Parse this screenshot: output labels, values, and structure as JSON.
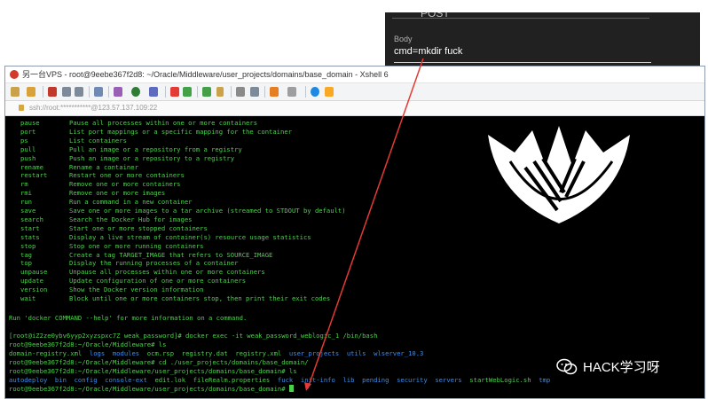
{
  "overlay": {
    "post_label": "POST",
    "body_label": "Body",
    "body_value": "cmd=mkdir fuck"
  },
  "window": {
    "title": "另一台VPS - root@9eebe367f2d8: ~/Oracle/Middleware/user_projects/domains/base_domain - Xshell 6",
    "address": "ssh://root:***********@123.57.137.109:22"
  },
  "help_rows": [
    {
      "cmd": "pause",
      "desc": "Pause all processes within one or more containers"
    },
    {
      "cmd": "port",
      "desc": "List port mappings or a specific mapping for the container"
    },
    {
      "cmd": "ps",
      "desc": "List containers"
    },
    {
      "cmd": "pull",
      "desc": "Pull an image or a repository from a registry"
    },
    {
      "cmd": "push",
      "desc": "Push an image or a repository to a registry"
    },
    {
      "cmd": "rename",
      "desc": "Rename a container"
    },
    {
      "cmd": "restart",
      "desc": "Restart one or more containers"
    },
    {
      "cmd": "rm",
      "desc": "Remove one or more containers"
    },
    {
      "cmd": "rmi",
      "desc": "Remove one or more images"
    },
    {
      "cmd": "run",
      "desc": "Run a command in a new container"
    },
    {
      "cmd": "save",
      "desc": "Save one or more images to a tar archive (streamed to STDOUT by default)"
    },
    {
      "cmd": "search",
      "desc": "Search the Docker Hub for images"
    },
    {
      "cmd": "start",
      "desc": "Start one or more stopped containers"
    },
    {
      "cmd": "stats",
      "desc": "Display a live stream of container(s) resource usage statistics"
    },
    {
      "cmd": "stop",
      "desc": "Stop one or more running containers"
    },
    {
      "cmd": "tag",
      "desc": "Create a tag TARGET_IMAGE that refers to SOURCE_IMAGE"
    },
    {
      "cmd": "top",
      "desc": "Display the running processes of a container"
    },
    {
      "cmd": "unpause",
      "desc": "Unpause all processes within one or more containers"
    },
    {
      "cmd": "update",
      "desc": "Update configuration of one or more containers"
    },
    {
      "cmd": "version",
      "desc": "Show the Docker version information"
    },
    {
      "cmd": "wait",
      "desc": "Block until one or more containers stop, then print their exit codes"
    }
  ],
  "help_footer": "Run 'docker COMMAND --help' for more information on a command.",
  "session": {
    "line1": "[root@iZ2ze0ybv6yyp2xyzspxc7Z weak_password]# docker exec -it weak_password_weblogic_1 /bin/bash",
    "line2": "root@9eebe367f2d8:~/Oracle/Middleware# ls",
    "ls1_white": "domain-registry.xml",
    "ls1_blue1": "logs  modules",
    "ls1_white2": "ocm.rsp  registry.dat  registry.xml",
    "ls1_blue2": "user_projects  utils  wlserver_10.3",
    "line4": "root@9eebe367f2d8:~/Oracle/Middleware# cd ./user_projects/domains/base_domain/",
    "line5": "root@9eebe367f2d8:~/Oracle/Middleware/user_projects/domains/base_domain# ls",
    "ls2_blue1": "autodeploy  bin  config  console-ext",
    "ls2_white1": "edit.lok  fileRealm.properties",
    "ls2_blue2": "fuck  init-info  lib  pending  security  servers",
    "ls2_white2": "startWebLogic.sh",
    "ls2_blue3": "tmp",
    "line7": "root@9eebe367f2d8:~/Oracle/Middleware/user_projects/domains/base_domain# "
  },
  "watermark": "HACK学习呀",
  "colors": {
    "terminal_text": "#4ad24a",
    "terminal_dir": "#3b8eea",
    "terminal_bg": "#000000",
    "arrow": "#e53935"
  }
}
